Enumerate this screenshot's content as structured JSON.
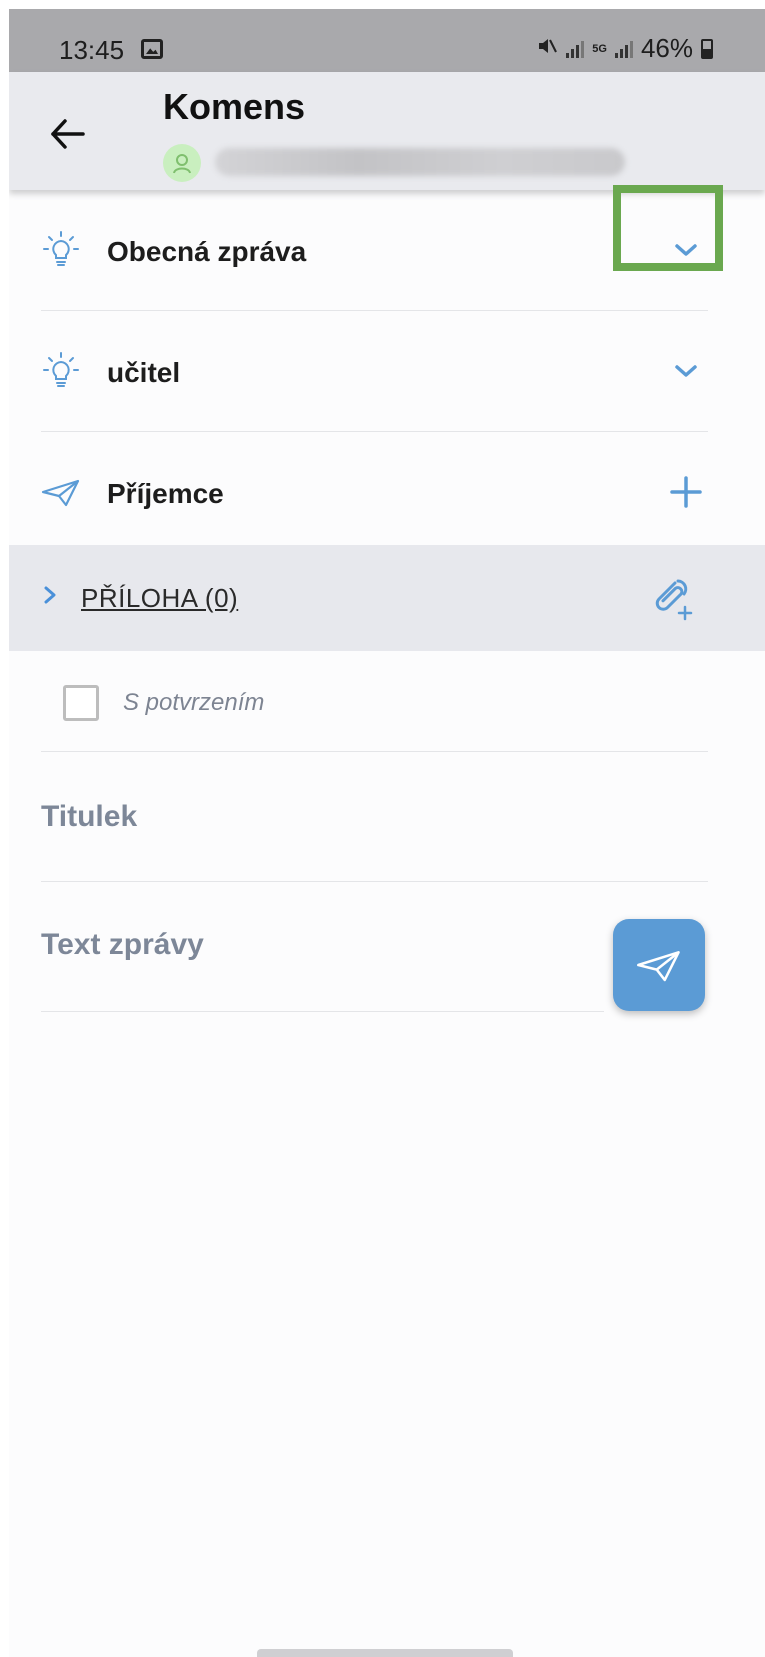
{
  "status_bar": {
    "time": "13:45",
    "net_type": "5G",
    "battery": "46%"
  },
  "header": {
    "title": "Komens",
    "back_icon": "arrow-left-icon",
    "avatar_icon": "user-avatar-icon"
  },
  "form": {
    "message_type": {
      "label": "Obecná zpráva",
      "icon": "lightbulb-icon",
      "action_icon": "chevron-down-icon"
    },
    "sender_role": {
      "label": "učitel",
      "icon": "lightbulb-icon",
      "action_icon": "chevron-down-icon"
    },
    "recipients": {
      "label": "Příjemce",
      "icon": "paper-plane-icon",
      "action_icon": "plus-icon"
    },
    "attachments": {
      "label": "PŘÍLOHA (0)",
      "icon": "paperclip-add-icon"
    },
    "confirmation": {
      "label": "S potvrzením",
      "checked": false
    },
    "title_field": {
      "placeholder": "Titulek"
    },
    "body_field": {
      "placeholder": "Text zprávy"
    }
  },
  "colors": {
    "accent": "#5b9bd5",
    "highlight": "#6aa84f",
    "header_bg": "#e9eaee",
    "status_bar_bg": "#a9a9ac"
  }
}
